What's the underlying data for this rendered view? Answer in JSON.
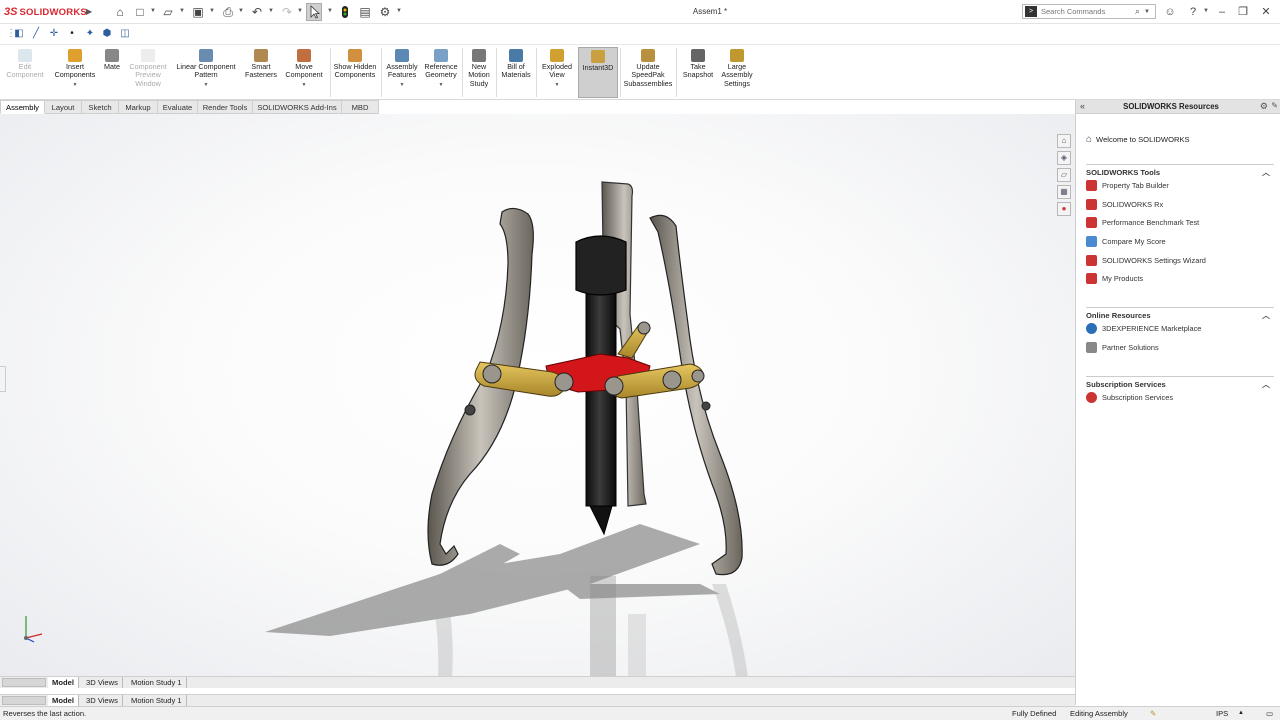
{
  "app": {
    "brand": "SOLIDWORKS",
    "document_title": "Assem1 *"
  },
  "quick_access": [
    "home-icon",
    "new-file-icon",
    "open-file-icon",
    "save-icon",
    "print-icon",
    "undo-icon",
    "redo-icon",
    "select-pointer-icon",
    "rebuild-icon",
    "file-properties-icon",
    "options-gear-icon"
  ],
  "search": {
    "placeholder": "Search Commands"
  },
  "window_controls": [
    "minimize-icon",
    "restore-icon",
    "close-icon"
  ],
  "command_manager": {
    "buttons": [
      {
        "id": "edit-component",
        "label": "Edit Component",
        "enabled": false
      },
      {
        "id": "insert-components",
        "label": "Insert Components",
        "enabled": true,
        "dropdown": true
      },
      {
        "id": "mate",
        "label": "Mate",
        "enabled": true
      },
      {
        "id": "component-preview-window",
        "label": "Component Preview Window",
        "enabled": false
      },
      {
        "id": "linear-component-pattern",
        "label": "Linear Component Pattern",
        "enabled": true,
        "dropdown": true
      },
      {
        "id": "smart-fasteners",
        "label": "Smart Fasteners",
        "enabled": true
      },
      {
        "id": "move-component",
        "label": "Move Component",
        "enabled": true,
        "dropdown": true
      },
      {
        "id": "show-hidden-components",
        "label": "Show Hidden Components",
        "enabled": true
      },
      {
        "id": "assembly-features",
        "label": "Assembly Features",
        "enabled": true,
        "dropdown": true
      },
      {
        "id": "reference-geometry",
        "label": "Reference Geometry",
        "enabled": true,
        "dropdown": true
      },
      {
        "id": "new-motion-study",
        "label": "New Motion Study",
        "enabled": true
      },
      {
        "id": "bill-of-materials",
        "label": "Bill of Materials",
        "enabled": true
      },
      {
        "id": "exploded-view",
        "label": "Exploded View",
        "enabled": true,
        "dropdown": true
      },
      {
        "id": "instant3d",
        "label": "Instant3D",
        "enabled": true,
        "active": true
      },
      {
        "id": "update-speedpak",
        "label": "Update SpeedPak Subassemblies",
        "enabled": true
      },
      {
        "id": "take-snapshot",
        "label": "Take Snapshot",
        "enabled": true
      },
      {
        "id": "large-assembly-settings",
        "label": "Large Assembly Settings",
        "enabled": true
      }
    ]
  },
  "tabs": [
    "Assembly",
    "Layout",
    "Sketch",
    "Markup",
    "Evaluate",
    "Render Tools",
    "SOLIDWORKS Add-Ins",
    "MBD"
  ],
  "active_tab": "Assembly",
  "task_pane": {
    "title": "SOLIDWORKS Resources",
    "welcome": "Welcome to SOLIDWORKS",
    "sections": [
      {
        "title": "SOLIDWORKS Tools",
        "items": [
          "Property Tab Builder",
          "SOLIDWORKS Rx",
          "Performance Benchmark Test",
          "Compare My Score",
          "SOLIDWORKS Settings Wizard",
          "My Products"
        ]
      },
      {
        "title": "Online Resources",
        "items": [
          "3DEXPERIENCE Marketplace",
          "Partner Solutions"
        ]
      },
      {
        "title": "Subscription Services",
        "items": [
          "Subscription Services"
        ]
      }
    ]
  },
  "bottom_tabs": [
    "Model",
    "3D Views",
    "Motion Study 1"
  ],
  "status": {
    "message": "Reverses the last action.",
    "state": "Fully Defined",
    "mode": "Editing Assembly",
    "units": "IPS"
  },
  "colors": {
    "brand_red": "#d7282f",
    "active_tool_bg": "#cfcfcf",
    "gear_puller_arm": "#9a958d",
    "collar_red": "#d2161a",
    "yoke_gold": "#d4b04a",
    "screw_black": "#1c1c1c"
  }
}
